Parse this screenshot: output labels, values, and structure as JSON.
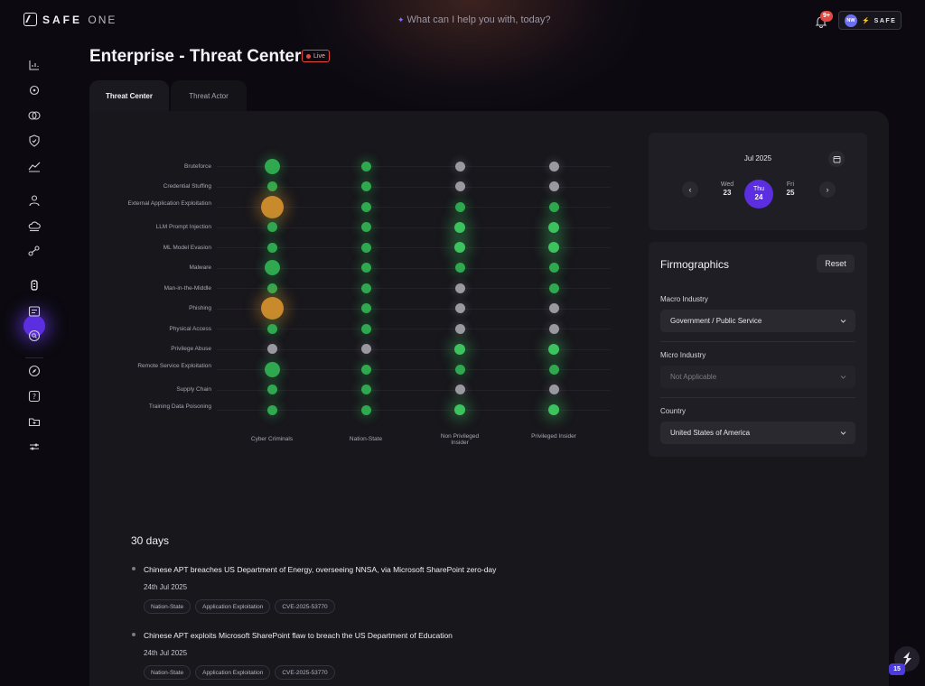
{
  "header": {
    "brand_bold": "SAFE",
    "brand_light": "ONE",
    "ask_placeholder": "What can I help you with, today?",
    "notifications_badge": "9+",
    "user_initials": "NW",
    "user_brand": "SAFE"
  },
  "page": {
    "title": "Enterprise - Threat Center",
    "live_label": "Live"
  },
  "tabs": [
    {
      "label": "Threat Center",
      "active": true
    },
    {
      "label": "Threat Actor",
      "active": false
    }
  ],
  "matrix": {
    "rows": [
      {
        "label": "Bruteforce"
      },
      {
        "label": "Credential Stuffing"
      },
      {
        "label": "External Application Exploitation"
      },
      {
        "label": "LLM Prompt Injection"
      },
      {
        "label": "ML Model Evasion"
      },
      {
        "label": "Malware"
      },
      {
        "label": "Man-in-the-Middle"
      },
      {
        "label": "Phishing"
      },
      {
        "label": "Physical Access"
      },
      {
        "label": "Privilege Abuse"
      },
      {
        "label": "Remote Service Exploitation"
      },
      {
        "label": "Supply Chain"
      },
      {
        "label": "Training Data Poisoning"
      }
    ],
    "columns": [
      "Cyber Criminals",
      "Nation-State",
      "Non Privileged Insider",
      "Privileged Insider"
    ],
    "cells": [
      [
        "green-large",
        "green",
        "gray",
        "gray"
      ],
      [
        "green",
        "green",
        "gray",
        "gray"
      ],
      [
        "orange-large",
        "green",
        "green",
        "green"
      ],
      [
        "green",
        "green",
        "green-bright",
        "green-bright"
      ],
      [
        "green",
        "green",
        "green-bright",
        "green-bright"
      ],
      [
        "green-large",
        "green",
        "green",
        "green"
      ],
      [
        "green",
        "green",
        "gray",
        "green"
      ],
      [
        "orange-large",
        "green",
        "gray",
        "gray"
      ],
      [
        "green",
        "green",
        "gray",
        "gray"
      ],
      [
        "gray",
        "gray",
        "green-bright",
        "green-bright"
      ],
      [
        "green-large",
        "green",
        "green",
        "green"
      ],
      [
        "green",
        "green",
        "gray",
        "gray"
      ],
      [
        "green",
        "green",
        "green-bright",
        "green-bright"
      ]
    ],
    "colors": {
      "green": "#2fa84f",
      "green_bright": "#3cc35e",
      "gray": "#9a99a0",
      "orange": "#c98a2b"
    }
  },
  "calendar": {
    "month": "Jul 2025",
    "days": [
      {
        "name": "Wed",
        "date": "23",
        "active": false
      },
      {
        "name": "Thu",
        "date": "24",
        "active": true
      },
      {
        "name": "Fri",
        "date": "25",
        "active": false
      }
    ],
    "accent": "#5b2fe0"
  },
  "firmographics": {
    "title": "Firmographics",
    "reset_label": "Reset",
    "fields": [
      {
        "label": "Macro Industry",
        "value": "Government / Public Service",
        "disabled": false
      },
      {
        "label": "Micro Industry",
        "value": "Not Applicable",
        "disabled": true
      },
      {
        "label": "Country",
        "value": "United States of America",
        "disabled": false
      }
    ]
  },
  "news": {
    "period": "30 days",
    "items": [
      {
        "title": "Chinese APT breaches US Department of Energy, overseeing NNSA, via Microsoft SharePoint zero-day",
        "date": "24th Jul 2025",
        "tags": [
          "Nation-State",
          "Application Exploitation",
          "CVE-2025-53770"
        ]
      },
      {
        "title": "Chinese APT exploits Microsoft SharePoint flaw to breach the US Department of Education",
        "date": "24th Jul 2025",
        "tags": [
          "Nation-State",
          "Application Exploitation",
          "CVE-2025-53770"
        ]
      }
    ]
  },
  "floating": {
    "badge": "15"
  },
  "icons": {
    "sidebar": [
      "dashboard-chart-icon",
      "target-icon",
      "toggle-icon",
      "shield-check-icon",
      "trend-line-icon",
      "user-icon",
      "cloud-icon",
      "nodes-icon",
      "threat-center-icon",
      "list-panel-icon",
      "search-circle-icon",
      "compass-icon",
      "help-icon",
      "folder-add-icon",
      "sliders-icon"
    ]
  }
}
